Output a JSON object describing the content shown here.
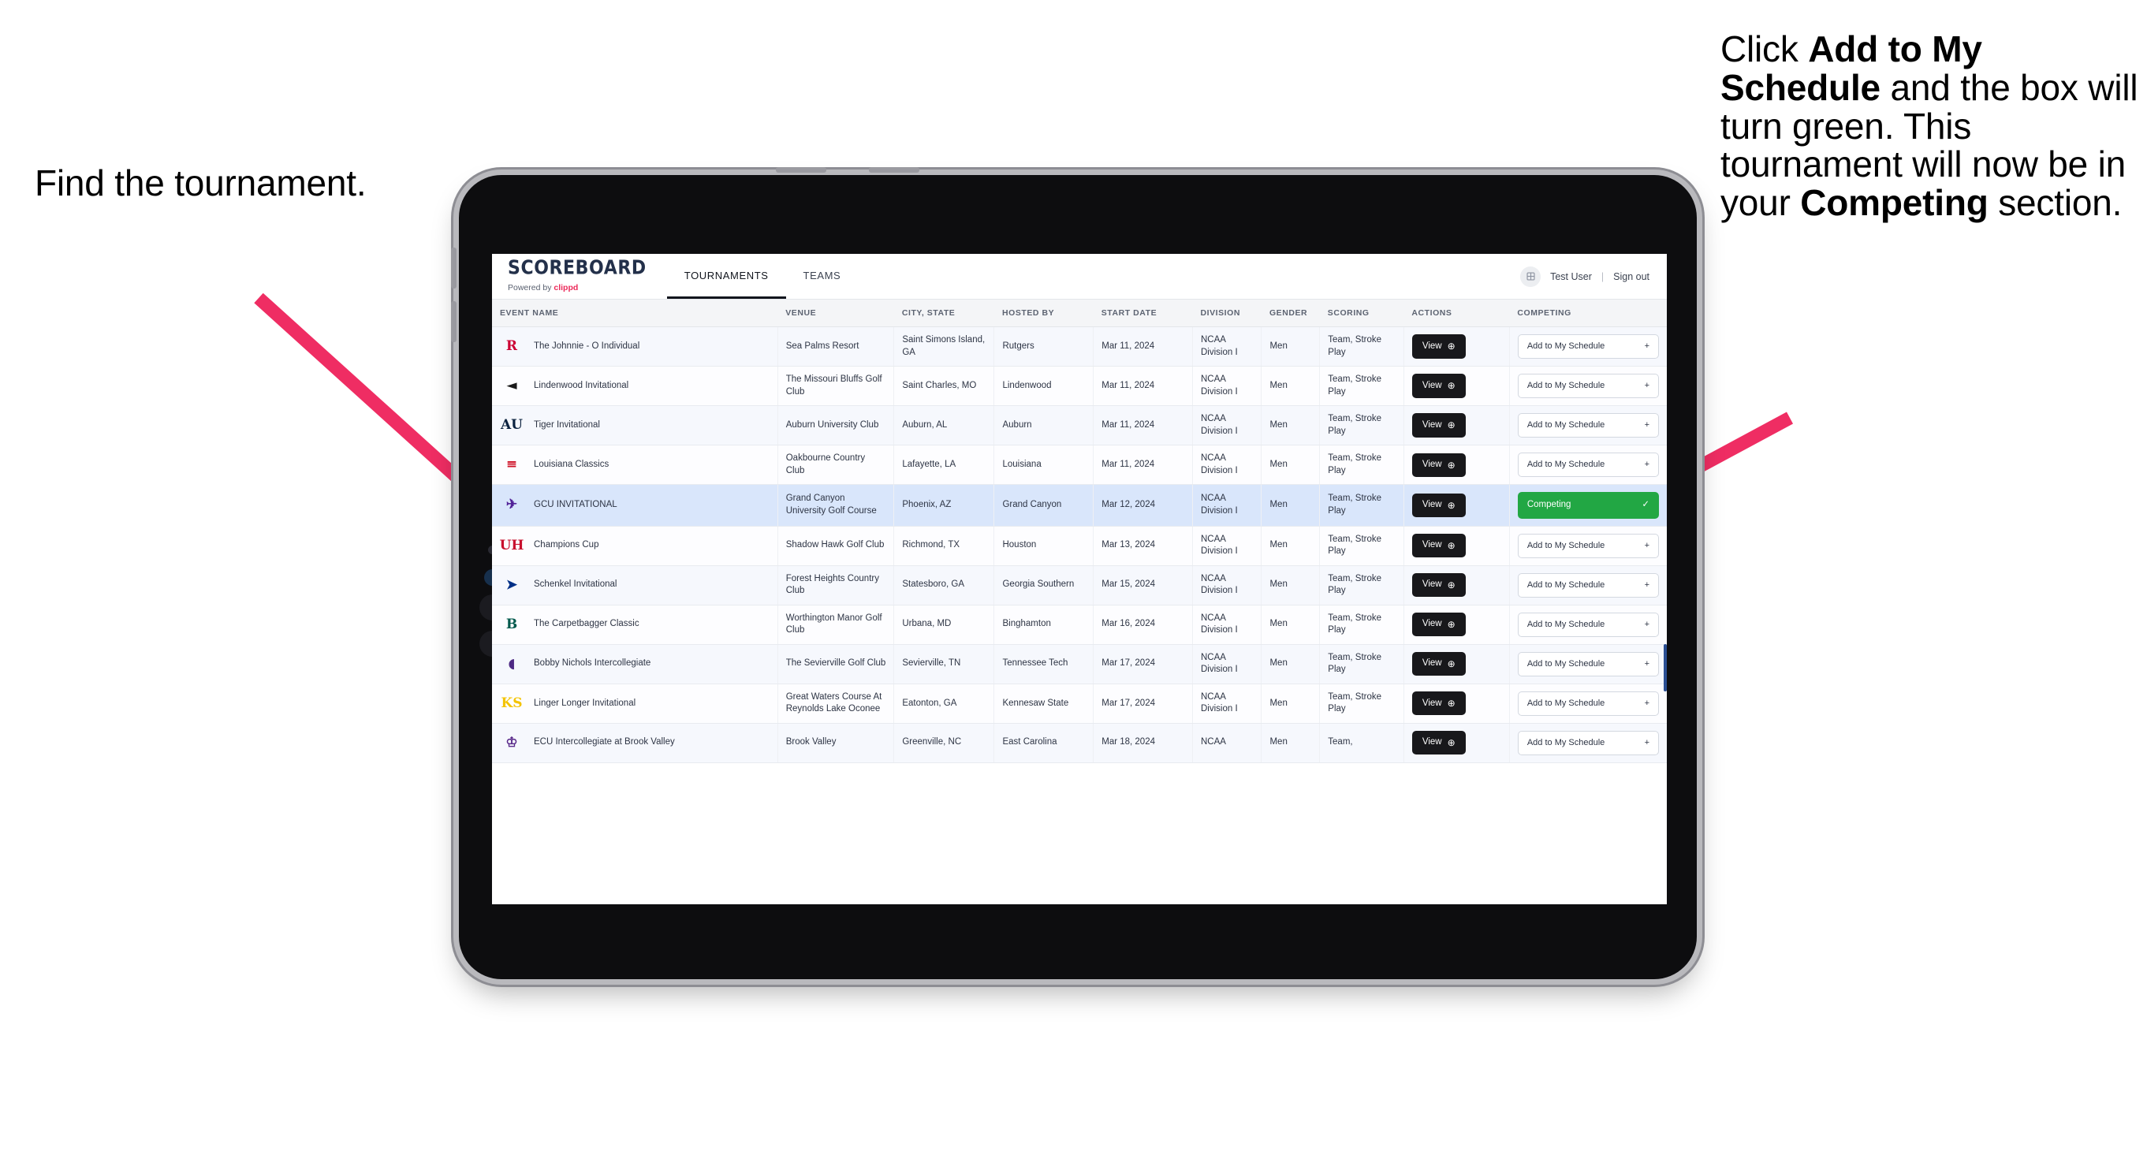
{
  "annotations": {
    "left": {
      "text": "Find the tournament."
    },
    "right": {
      "parts": [
        {
          "t": "Click ",
          "b": false
        },
        {
          "t": "Add to My Schedule",
          "b": true
        },
        {
          "t": " and the box will turn green. This tournament will now be in your ",
          "b": false
        },
        {
          "t": "Competing",
          "b": true
        },
        {
          "t": " section.",
          "b": false
        }
      ]
    },
    "arrow_color": "#ef2d63"
  },
  "app": {
    "brand": {
      "title": "SCOREBOARD",
      "powered_prefix": "Powered by ",
      "powered_brand": "clippd"
    },
    "nav": [
      {
        "label": "TOURNAMENTS",
        "active": true
      },
      {
        "label": "TEAMS",
        "active": false
      }
    ],
    "header_right": {
      "avatar_icon": "user-avatar-icon",
      "user": "Test User",
      "separator": "|",
      "signout": "Sign out"
    },
    "columns": [
      "EVENT NAME",
      "VENUE",
      "CITY, STATE",
      "HOSTED BY",
      "START DATE",
      "DIVISION",
      "GENDER",
      "SCORING",
      "ACTIONS",
      "COMPETING"
    ],
    "action_labels": {
      "view": "View",
      "view_icon": "arrow-right-circle-icon",
      "add": "Add to My Schedule",
      "add_icon": "plus-icon",
      "competing": "Competing",
      "competing_icon": "check-icon"
    },
    "accent_colors": {
      "competing_green": "#22a744",
      "brand_pink": "#ec2a5a",
      "selected_row": "#d9e6fb",
      "view_black": "#18181b"
    },
    "rows": [
      {
        "logo": "R",
        "logo_color": "#cc0033",
        "event": "The Johnnie - O Individual",
        "venue": "Sea Palms Resort",
        "city": "Saint Simons Island, GA",
        "host": "Rutgers",
        "date": "Mar 11, 2024",
        "division": "NCAA Division I",
        "gender": "Men",
        "scoring": "Team, Stroke Play",
        "competing": false,
        "selected": false
      },
      {
        "logo": "◄",
        "logo_color": "#1a1a1a",
        "event": "Lindenwood Invitational",
        "venue": "The Missouri Bluffs Golf Club",
        "city": "Saint Charles, MO",
        "host": "Lindenwood",
        "date": "Mar 11, 2024",
        "division": "NCAA Division I",
        "gender": "Men",
        "scoring": "Team, Stroke Play",
        "competing": false,
        "selected": false
      },
      {
        "logo": "AU",
        "logo_color": "#0c2340",
        "event": "Tiger Invitational",
        "venue": "Auburn University Club",
        "city": "Auburn, AL",
        "host": "Auburn",
        "date": "Mar 11, 2024",
        "division": "NCAA Division I",
        "gender": "Men",
        "scoring": "Team, Stroke Play",
        "competing": false,
        "selected": false
      },
      {
        "logo": "≡",
        "logo_color": "#ce1126",
        "event": "Louisiana Classics",
        "venue": "Oakbourne Country Club",
        "city": "Lafayette, LA",
        "host": "Louisiana",
        "date": "Mar 11, 2024",
        "division": "NCAA Division I",
        "gender": "Men",
        "scoring": "Team, Stroke Play",
        "competing": false,
        "selected": false
      },
      {
        "logo": "✈",
        "logo_color": "#522398",
        "event": "GCU INVITATIONAL",
        "venue": "Grand Canyon University Golf Course",
        "city": "Phoenix, AZ",
        "host": "Grand Canyon",
        "date": "Mar 12, 2024",
        "division": "NCAA Division I",
        "gender": "Men",
        "scoring": "Team, Stroke Play",
        "competing": true,
        "selected": true
      },
      {
        "logo": "UH",
        "logo_color": "#c8102e",
        "event": "Champions Cup",
        "venue": "Shadow Hawk Golf Club",
        "city": "Richmond, TX",
        "host": "Houston",
        "date": "Mar 13, 2024",
        "division": "NCAA Division I",
        "gender": "Men",
        "scoring": "Team, Stroke Play",
        "competing": false,
        "selected": false
      },
      {
        "logo": "➤",
        "logo_color": "#003087",
        "event": "Schenkel Invitational",
        "venue": "Forest Heights Country Club",
        "city": "Statesboro, GA",
        "host": "Georgia Southern",
        "date": "Mar 15, 2024",
        "division": "NCAA Division I",
        "gender": "Men",
        "scoring": "Team, Stroke Play",
        "competing": false,
        "selected": false
      },
      {
        "logo": "B",
        "logo_color": "#00594c",
        "event": "The Carpetbagger Classic",
        "venue": "Worthington Manor Golf Club",
        "city": "Urbana, MD",
        "host": "Binghamton",
        "date": "Mar 16, 2024",
        "division": "NCAA Division I",
        "gender": "Men",
        "scoring": "Team, Stroke Play",
        "competing": false,
        "selected": false
      },
      {
        "logo": "◖",
        "logo_color": "#4e2a84",
        "event": "Bobby Nichols Intercollegiate",
        "venue": "The Sevierville Golf Club",
        "city": "Sevierville, TN",
        "host": "Tennessee Tech",
        "date": "Mar 17, 2024",
        "division": "NCAA Division I",
        "gender": "Men",
        "scoring": "Team, Stroke Play",
        "competing": false,
        "selected": false
      },
      {
        "logo": "KS",
        "logo_color": "#f3c300",
        "event": "Linger Longer Invitational",
        "venue": "Great Waters Course At Reynolds Lake Oconee",
        "city": "Eatonton, GA",
        "host": "Kennesaw State",
        "date": "Mar 17, 2024",
        "division": "NCAA Division I",
        "gender": "Men",
        "scoring": "Team, Stroke Play",
        "competing": false,
        "selected": false
      },
      {
        "logo": "♔",
        "logo_color": "#592a8a",
        "event": "ECU Intercollegiate at Brook Valley",
        "venue": "Brook Valley",
        "city": "Greenville, NC",
        "host": "East Carolina",
        "date": "Mar 18, 2024",
        "division": "NCAA",
        "gender": "Men",
        "scoring": "Team,",
        "competing": false,
        "selected": false
      }
    ]
  }
}
